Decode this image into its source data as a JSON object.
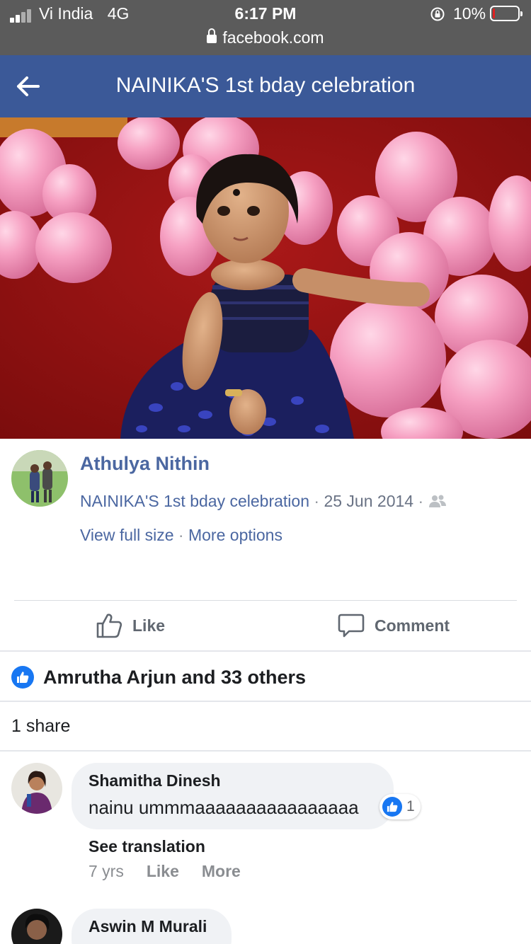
{
  "status_bar": {
    "carrier": "Vi India",
    "network": "4G",
    "time": "6:17 PM",
    "url": "facebook.com",
    "battery_percent_text": "10%",
    "battery_level": 0.1,
    "battery_color": "#e02020"
  },
  "header": {
    "title": "NAINIKA'S 1st bday celebration",
    "back_icon": "back-arrow-icon",
    "color": "#3b5998"
  },
  "photo": {
    "description_icon": "photo"
  },
  "post": {
    "author": "Athulya Nithin",
    "album": "NAINIKA'S 1st bday celebration",
    "date": "25 Jun 2014",
    "privacy_icon": "friends-icon",
    "view_full_size": "View full size",
    "more_options": "More options",
    "separator": "·"
  },
  "actions": {
    "like": "Like",
    "comment": "Comment"
  },
  "reactions": {
    "summary": "Amrutha Arjun and 33 others"
  },
  "shares": {
    "text": "1 share"
  },
  "comments": [
    {
      "name": "Shamitha Dinesh",
      "text": "nainu ummmaaaaaaaaaaaaaaaa",
      "reaction_count": "1",
      "see_translation": "See translation",
      "time": "7 yrs",
      "like": "Like",
      "more": "More"
    },
    {
      "name": "Aswin M Murali"
    }
  ]
}
